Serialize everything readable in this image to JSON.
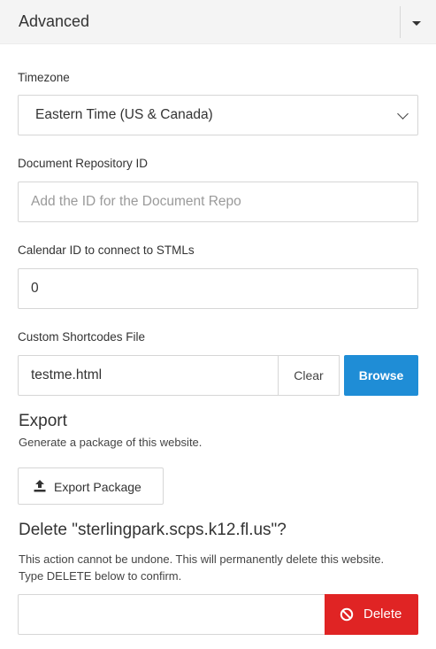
{
  "header": {
    "title": "Advanced",
    "toggle_icon": "caret-down-icon"
  },
  "timezone": {
    "label": "Timezone",
    "value": "Eastern Time (US & Canada)"
  },
  "document_repo": {
    "label": "Document Repository ID",
    "value": "",
    "placeholder": "Add the ID for the Document Repo"
  },
  "calendar": {
    "label": "Calendar ID to connect to STMLs",
    "value": "0"
  },
  "shortcodes": {
    "label": "Custom Shortcodes File",
    "value": "testme.html",
    "clear_label": "Clear",
    "browse_label": "Browse",
    "browse_color": "#1f8dd6"
  },
  "export": {
    "title": "Export",
    "description": "Generate a package of this website.",
    "button_label": "Export Package",
    "button_icon": "upload-icon"
  },
  "delete": {
    "title": "Delete \"sterlingpark.scps.k12.fl.us\"?",
    "description": "This action cannot be undone. This will permanently delete this website. Type DELETE below to confirm.",
    "input_value": "",
    "button_label": "Delete",
    "button_icon": "ban-icon",
    "button_color": "#e02424"
  }
}
